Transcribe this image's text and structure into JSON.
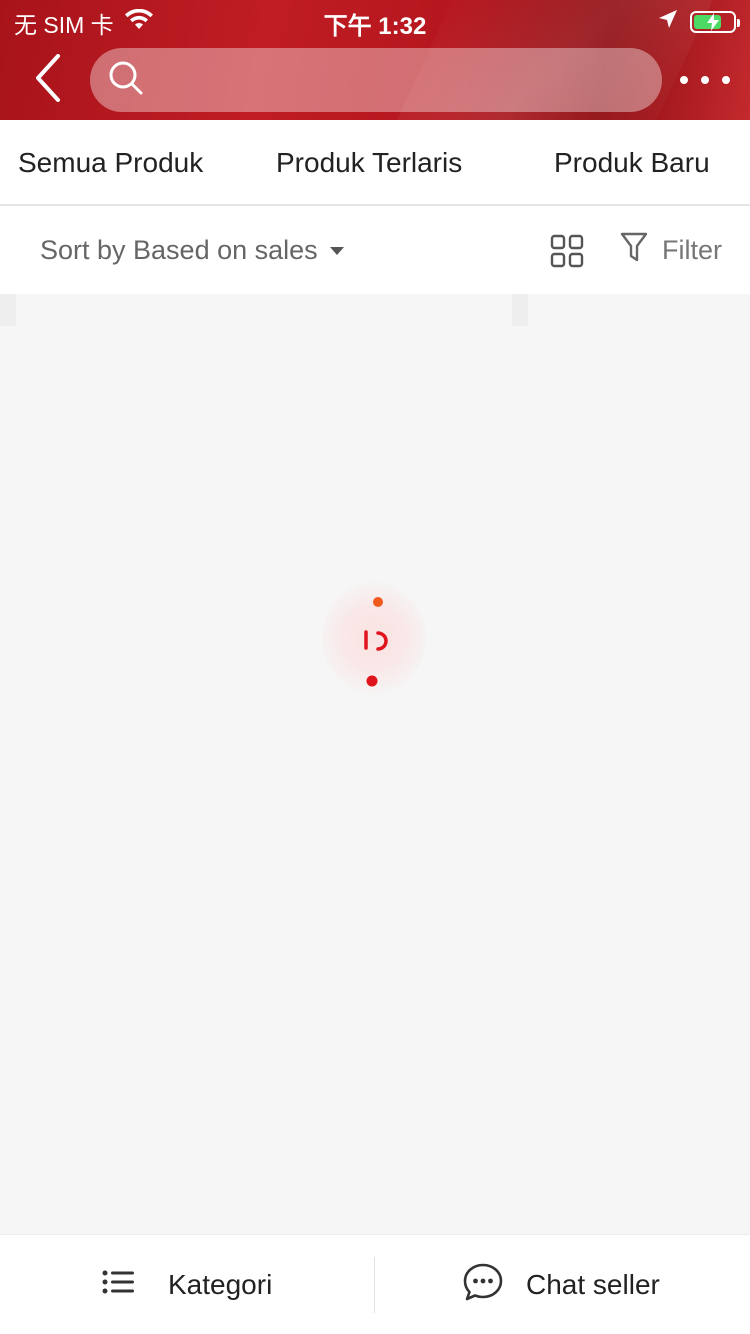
{
  "status_bar": {
    "carrier": "无 SIM 卡",
    "time": "下午 1:32",
    "battery_color": "#4cd964"
  },
  "header": {
    "back_icon": "chevron-left-icon",
    "search_icon": "search-icon",
    "search_placeholder": "",
    "more_icon": "more-horizontal-icon",
    "accent_color": "#b5161d"
  },
  "tabs": [
    {
      "label": "Semua Produk"
    },
    {
      "label": "Produk Terlaris"
    },
    {
      "label": "Produk Baru"
    }
  ],
  "sortbar": {
    "sort_label": "Sort by Based on sales",
    "grid_icon": "grid-view-icon",
    "filter_label": "Filter",
    "filter_icon": "filter-icon"
  },
  "content": {
    "loading_icon": "loading-spinner-icon"
  },
  "bottombar": {
    "kategori_label": "Kategori",
    "kategori_icon": "list-icon",
    "chat_label": "Chat seller",
    "chat_icon": "chat-bubble-icon"
  }
}
